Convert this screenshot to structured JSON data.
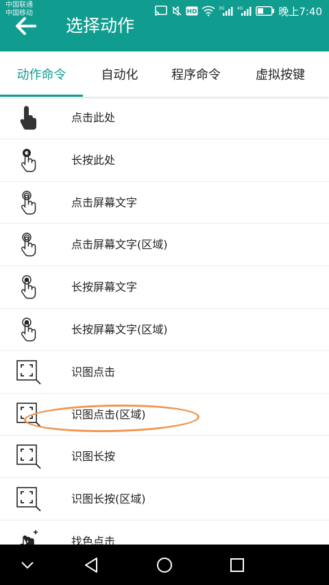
{
  "status_bar": {
    "carrier_1": "中国联通",
    "carrier_2": "中国移动",
    "time": "晚上7:40",
    "icons": [
      "cast-icon",
      "mute-icon",
      "hd-icon",
      "wifi-icon",
      "signal-3g-icon",
      "signal-4g-icon",
      "battery-icon"
    ]
  },
  "app_bar": {
    "title": "选择动作",
    "back_icon": "arrow-left-icon",
    "background": "#109c8f"
  },
  "tabs": [
    {
      "label": "动作命令",
      "active": true
    },
    {
      "label": "自动化",
      "active": false
    },
    {
      "label": "程序命令",
      "active": false
    },
    {
      "label": "虚拟按键",
      "active": false
    }
  ],
  "actions": [
    {
      "label": "点击此处",
      "icon": "tap-here-icon"
    },
    {
      "label": "长按此处",
      "icon": "long-press-here-icon"
    },
    {
      "label": "点击屏幕文字",
      "icon": "tap-text-icon"
    },
    {
      "label": "点击屏幕文字(区域)",
      "icon": "tap-text-region-icon"
    },
    {
      "label": "长按屏幕文字",
      "icon": "long-press-text-icon"
    },
    {
      "label": "长按屏幕文字(区域)",
      "icon": "long-press-text-region-icon"
    },
    {
      "label": "识图点击",
      "icon": "image-scan-icon"
    },
    {
      "label": "识图点击(区域)",
      "icon": "image-scan-icon"
    },
    {
      "label": "识图长按",
      "icon": "image-scan-icon"
    },
    {
      "label": "识图长按(区域)",
      "icon": "image-scan-icon"
    },
    {
      "label": "找色点击",
      "icon": "color-tap-icon"
    }
  ],
  "highlighted_action": "识图点击(区域)",
  "colors": {
    "accent": "#109c8f",
    "annotation": "#f0954e"
  },
  "nav_bar": {
    "icons": [
      "collapse-icon",
      "back-triangle-icon",
      "home-circle-icon",
      "recents-square-icon"
    ]
  }
}
